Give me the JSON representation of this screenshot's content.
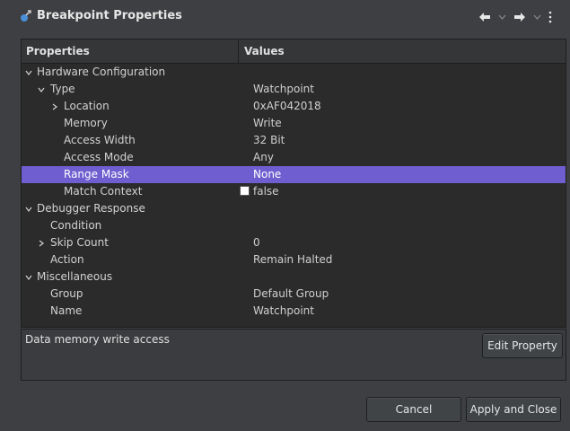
{
  "window": {
    "title": "Breakpoint Properties",
    "title_icon": "breakpoint-properties-icon"
  },
  "toolbar": {
    "back_icon": "arrow-left-icon",
    "back_dropdown_icon": "chevron-down-icon",
    "forward_icon": "arrow-right-icon",
    "forward_dropdown_icon": "chevron-down-icon",
    "menu_icon": "kebab-menu-icon"
  },
  "tree": {
    "headers": {
      "properties": "Properties",
      "values": "Values"
    },
    "rows": [
      {
        "label": "Hardware Configuration",
        "value": "",
        "twisty": "expanded"
      },
      {
        "label": "Type",
        "value": "Watchpoint",
        "twisty": "expanded"
      },
      {
        "label": "Location",
        "value": "0xAF042018",
        "twisty": "collapsed"
      },
      {
        "label": "Memory",
        "value": "Write",
        "twisty": "none"
      },
      {
        "label": "Access Width",
        "value": "32 Bit",
        "twisty": "none"
      },
      {
        "label": "Access Mode",
        "value": "Any",
        "twisty": "none"
      },
      {
        "label": "Range Mask",
        "value": "None",
        "twisty": "none",
        "selected": true
      },
      {
        "label": "Match Context",
        "value": "false",
        "twisty": "none",
        "checkbox": true,
        "checked": false
      },
      {
        "label": "Debugger Response",
        "value": "",
        "twisty": "expanded"
      },
      {
        "label": "Condition",
        "value": "",
        "twisty": "none"
      },
      {
        "label": "Skip Count",
        "value": "0",
        "twisty": "collapsed"
      },
      {
        "label": "Action",
        "value": "Remain Halted",
        "twisty": "none"
      },
      {
        "label": "Miscellaneous",
        "value": "",
        "twisty": "expanded"
      },
      {
        "label": "Group",
        "value": "Default Group",
        "twisty": "none"
      },
      {
        "label": "Name",
        "value": "Watchpoint",
        "twisty": "none"
      }
    ]
  },
  "description": {
    "text": "Data memory write access",
    "edit_button": "Edit Property"
  },
  "footer": {
    "cancel": "Cancel",
    "apply": "Apply and Close"
  },
  "colors": {
    "selection": "#6f5ecf",
    "background": "#3d3f42",
    "tree_background": "#2b2b2b"
  }
}
